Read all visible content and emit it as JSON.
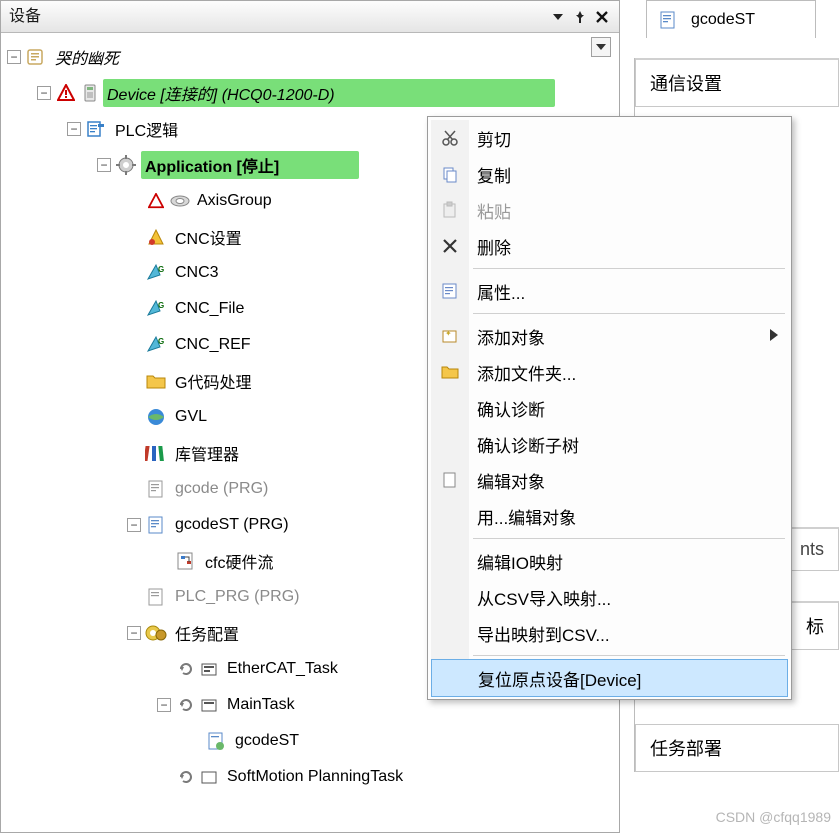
{
  "panel": {
    "title": "设备"
  },
  "tree": {
    "root": "哭的幽死",
    "device": "Device [连接的] (HCQ0-1200-D)",
    "plc_logic": "PLC逻辑",
    "application": "Application [停止]",
    "items": {
      "axisgroup": "AxisGroup",
      "cnc_set": "CNC设置",
      "cnc3": "CNC3",
      "cnc_file": "CNC_File",
      "cnc_ref": "CNC_REF",
      "gcode_proc": "G代码处理",
      "gvl": "GVL",
      "lib_mgr": "库管理器",
      "gcode_prg": "gcode (PRG)",
      "gcodest_prg": "gcodeST (PRG)",
      "cfc_hw": "cfc硬件流",
      "plc_prg": "PLC_PRG (PRG)",
      "task_cfg": "任务配置",
      "ethercat_task": "EtherCAT_Task",
      "maintask": "MainTask",
      "gcodest_ref": "gcodeST",
      "sm_plan": "SoftMotion PlanningTask"
    }
  },
  "ctx": {
    "cut": "剪切",
    "copy": "复制",
    "paste": "粘贴",
    "delete": "删除",
    "properties": "属性...",
    "add_object": "添加对象",
    "add_folder": "添加文件夹...",
    "confirm_diag": "确认诊断",
    "confirm_diag_sub": "确认诊断子树",
    "edit_object": "编辑对象",
    "edit_with": "用...编辑对象",
    "edit_io": "编辑IO映射",
    "import_csv": "从CSV导入映射...",
    "export_csv": "导出映射到CSV...",
    "reset_origin": "复位原点设备[Device]"
  },
  "right": {
    "tab": "gcodeST",
    "section": "通信设置",
    "partial1": "nts",
    "partial2": "标",
    "taskdeploy": "任务部署"
  },
  "watermark": "CSDN @cfqq1989"
}
